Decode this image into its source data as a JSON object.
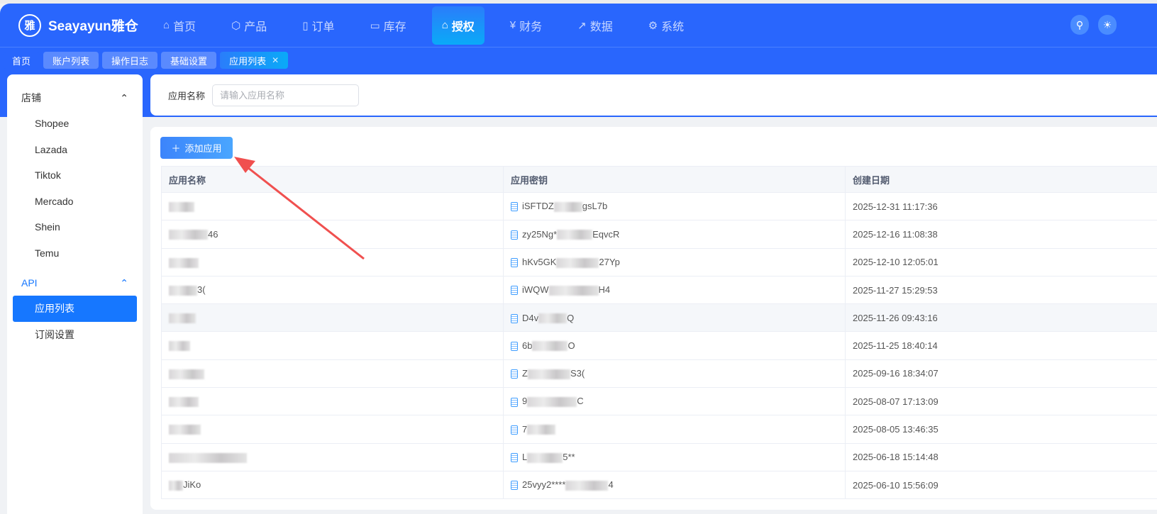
{
  "header": {
    "brand": "Seayayun雅仓",
    "logo_glyph": "雅",
    "nav": [
      {
        "label": "首页",
        "icon": "home-icon",
        "glyph": "⌂"
      },
      {
        "label": "产品",
        "icon": "box-icon",
        "glyph": "⬡"
      },
      {
        "label": "订单",
        "icon": "clipboard-icon",
        "glyph": "▯"
      },
      {
        "label": "库存",
        "icon": "store-icon",
        "glyph": "▭"
      },
      {
        "label": "授权",
        "icon": "authorize-icon",
        "glyph": "⌂",
        "active": true
      },
      {
        "label": "财务",
        "icon": "yen-icon",
        "glyph": "¥"
      },
      {
        "label": "数据",
        "icon": "chart-icon",
        "glyph": "↗"
      },
      {
        "label": "系统",
        "icon": "gear-icon",
        "glyph": "⚙"
      }
    ]
  },
  "tabs": [
    {
      "label": "首页"
    },
    {
      "label": "账户列表"
    },
    {
      "label": "操作日志"
    },
    {
      "label": "基础设置"
    },
    {
      "label": "应用列表",
      "active": true
    }
  ],
  "sidebar": {
    "group1": "店铺",
    "items1": [
      "Shopee",
      "Lazada",
      "Tiktok",
      "Mercado",
      "Shein",
      "Temu"
    ],
    "group2": "API",
    "items2": [
      "应用列表",
      "订阅设置"
    ]
  },
  "filter": {
    "label": "应用名称",
    "placeholder": "请输入应用名称"
  },
  "toolbar": {
    "add_label": "添加应用"
  },
  "table": {
    "columns": [
      "应用名称",
      "应用密钥",
      "创建日期"
    ],
    "rows": [
      {
        "name": "",
        "key_pre": "iSFTDZ",
        "key_post": "gsL7b",
        "date": "2025-12-31 11:17:36"
      },
      {
        "name": "46",
        "key_pre": "zy25Ng*",
        "key_post": "EqvcR",
        "date": "2025-12-16 11:08:38"
      },
      {
        "name": "",
        "key_pre": "hKv5GK",
        "key_post": "27Yp",
        "date": "2025-12-10 12:05:01"
      },
      {
        "name": "3(",
        "key_pre": "iWQW",
        "key_post": "H4",
        "date": "2025-11-27 15:29:53"
      },
      {
        "name": "",
        "key_pre": "D4v",
        "key_post": "Q",
        "date": "2025-11-26 09:43:16"
      },
      {
        "name": "",
        "key_pre": "6b",
        "key_post": "O",
        "date": "2025-11-25 18:40:14"
      },
      {
        "name": "",
        "key_pre": "Z",
        "key_post": "S3(",
        "date": "2025-09-16 18:34:07"
      },
      {
        "name": "",
        "key_pre": "9",
        "key_post": "C",
        "date": "2025-08-07 17:13:09"
      },
      {
        "name": "",
        "key_pre": "7",
        "key_post": "",
        "date": "2025-08-05 13:46:35"
      },
      {
        "name": "",
        "key_pre": "L",
        "key_post": "5**",
        "date": "2025-06-18 15:14:48"
      },
      {
        "name": "JiKo",
        "key_pre": "25vyy2****",
        "key_post": "4",
        "date": "2025-06-10 15:56:09"
      }
    ]
  }
}
